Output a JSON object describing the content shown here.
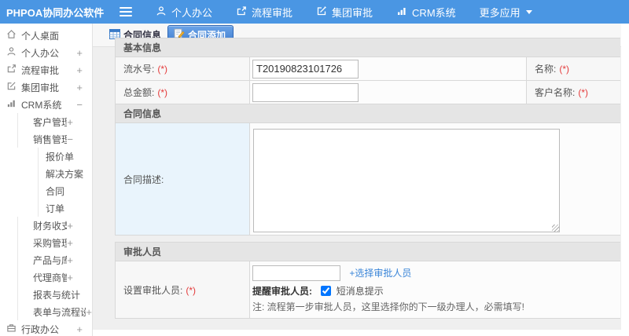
{
  "topbar": {
    "logo": "PHPOA协同办公软件",
    "nav": [
      {
        "label": "个人办公",
        "icon": "user-icon"
      },
      {
        "label": "流程审批",
        "icon": "flow-icon"
      },
      {
        "label": "集团审批",
        "icon": "edit-icon"
      },
      {
        "label": "CRM系统",
        "icon": "chart-icon"
      },
      {
        "label": "更多应用",
        "icon": "caret-down-icon"
      }
    ]
  },
  "sidebar": {
    "items": [
      {
        "label": "个人桌面",
        "level": 0,
        "icon": "home-icon"
      },
      {
        "label": "个人办公",
        "level": 0,
        "icon": "user-icon",
        "expand": "+"
      },
      {
        "label": "流程审批",
        "level": 0,
        "icon": "flow-icon",
        "expand": "+"
      },
      {
        "label": "集团审批",
        "level": 0,
        "icon": "edit-icon",
        "expand": "+"
      },
      {
        "label": "CRM系统",
        "level": 0,
        "icon": "chart-icon",
        "expand": "−"
      },
      {
        "label": "客户管理",
        "level": 1,
        "expand": "+"
      },
      {
        "label": "销售管理",
        "level": 1,
        "expand": "−"
      },
      {
        "label": "报价单",
        "level": 2
      },
      {
        "label": "解决方案",
        "level": 2
      },
      {
        "label": "合同",
        "level": 2
      },
      {
        "label": "订单",
        "level": 2
      },
      {
        "label": "财务收支",
        "level": 1,
        "expand": "+"
      },
      {
        "label": "采购管理",
        "level": 1,
        "expand": "+"
      },
      {
        "label": "产品与库存",
        "level": 1,
        "expand": "+"
      },
      {
        "label": "代理商管理",
        "level": 1,
        "expand": "+"
      },
      {
        "label": "报表与统计",
        "level": 1
      },
      {
        "label": "表单与流程设置",
        "level": 1,
        "expand": "+"
      },
      {
        "label": "行政办公",
        "level": 0,
        "icon": "org-icon",
        "expand": "+"
      }
    ]
  },
  "tabs": [
    {
      "label": "合同信息",
      "active": false
    },
    {
      "label": "合同添加",
      "active": true
    }
  ],
  "form": {
    "sections": {
      "basic": "基本信息",
      "contract": "合同信息",
      "approver": "审批人员"
    },
    "fields": {
      "serial": {
        "label": "流水号:",
        "required": "(*)",
        "value": "T20190823101726"
      },
      "name": {
        "label": "名称:",
        "required": "(*)"
      },
      "amount": {
        "label": "总金额:",
        "required": "(*)"
      },
      "customer": {
        "label": "客户名称:",
        "required": "(*)"
      },
      "desc": {
        "label": "合同描述:"
      },
      "approver": {
        "label": "设置审批人员:",
        "required": "(*)"
      },
      "choose_link": "+选择审批人员",
      "remind_label": "提醒审批人员:",
      "sms_label": "短消息提示",
      "sms_checked": "checked",
      "note": "注: 流程第一步审批人员，这里选择你的下一级办理人，必需填写!"
    }
  },
  "colors": {
    "topbar_blue": "#4a96e3",
    "active_tab_blue": "#3a78cc",
    "link_blue": "#3a85d8",
    "required_red": "#e43b3b",
    "desc_label_bg": "#e9f4fc"
  }
}
